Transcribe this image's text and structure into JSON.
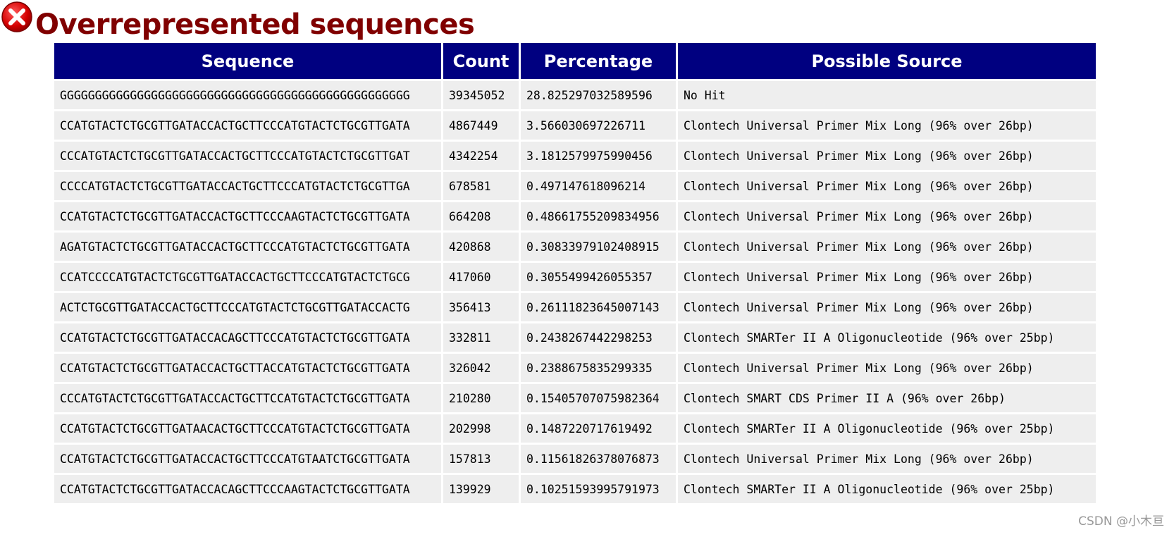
{
  "status": {
    "icon": "error-cross-icon",
    "color": "#cc0000"
  },
  "title": "Overrepresented sequences",
  "table": {
    "headers": {
      "sequence": "Sequence",
      "count": "Count",
      "percentage": "Percentage",
      "source": "Possible Source"
    },
    "rows": [
      {
        "sequence": "GGGGGGGGGGGGGGGGGGGGGGGGGGGGGGGGGGGGGGGGGGGGGGGGGG",
        "count": "39345052",
        "percentage": "28.825297032589596",
        "source": "No Hit"
      },
      {
        "sequence": "CCATGTACTCTGCGTTGATACCACTGCTTCCCATGTACTCTGCGTTGATA",
        "count": "4867449",
        "percentage": "3.566030697226711",
        "source": "Clontech Universal Primer Mix Long (96% over 26bp)"
      },
      {
        "sequence": "CCCATGTACTCTGCGTTGATACCACTGCTTCCCATGTACTCTGCGTTGAT",
        "count": "4342254",
        "percentage": "3.1812579975990456",
        "source": "Clontech Universal Primer Mix Long (96% over 26bp)"
      },
      {
        "sequence": "CCCCATGTACTCTGCGTTGATACCACTGCTTCCCATGTACTCTGCGTTGA",
        "count": "678581",
        "percentage": "0.497147618096214",
        "source": "Clontech Universal Primer Mix Long (96% over 26bp)"
      },
      {
        "sequence": "CCATGTACTCTGCGTTGATACCACTGCTTCCCAAGTACTCTGCGTTGATA",
        "count": "664208",
        "percentage": "0.48661755209834956",
        "source": "Clontech Universal Primer Mix Long (96% over 26bp)"
      },
      {
        "sequence": "AGATGTACTCTGCGTTGATACCACTGCTTCCCATGTACTCTGCGTTGATA",
        "count": "420868",
        "percentage": "0.30833979102408915",
        "source": "Clontech Universal Primer Mix Long (96% over 26bp)"
      },
      {
        "sequence": "CCATCCCCATGTACTCTGCGTTGATACCACTGCTTCCCATGTACTCTGCG",
        "count": "417060",
        "percentage": "0.3055499426055357",
        "source": "Clontech Universal Primer Mix Long (96% over 26bp)"
      },
      {
        "sequence": "ACTCTGCGTTGATACCACTGCTTCCCATGTACTCTGCGTTGATACCACTG",
        "count": "356413",
        "percentage": "0.26111823645007143",
        "source": "Clontech Universal Primer Mix Long (96% over 26bp)"
      },
      {
        "sequence": "CCATGTACTCTGCGTTGATACCACAGCTTCCCATGTACTCTGCGTTGATA",
        "count": "332811",
        "percentage": "0.2438267442298253",
        "source": "Clontech SMARTer II A Oligonucleotide (96% over 25bp)"
      },
      {
        "sequence": "CCATGTACTCTGCGTTGATACCACTGCTTACCATGTACTCTGCGTTGATA",
        "count": "326042",
        "percentage": "0.2388675835299335",
        "source": "Clontech Universal Primer Mix Long (96% over 26bp)"
      },
      {
        "sequence": "CCCATGTACTCTGCGTTGATACCACTGCTTCCATGTACTCTGCGTTGATA",
        "count": "210280",
        "percentage": "0.15405707075982364",
        "source": "Clontech SMART CDS Primer II A (96% over 26bp)"
      },
      {
        "sequence": "CCATGTACTCTGCGTTGATAACACTGCTTCCCATGTACTCTGCGTTGATA",
        "count": "202998",
        "percentage": "0.1487220717619492",
        "source": "Clontech SMARTer II A Oligonucleotide (96% over 25bp)"
      },
      {
        "sequence": "CCATGTACTCTGCGTTGATACCACTGCTTCCCATGTAATCTGCGTTGATA",
        "count": "157813",
        "percentage": "0.11561826378076873",
        "source": "Clontech Universal Primer Mix Long (96% over 26bp)"
      },
      {
        "sequence": "CCATGTACTCTGCGTTGATACCACAGCTTCCCAAGTACTCTGCGTTGATA",
        "count": "139929",
        "percentage": "0.10251593995791973",
        "source": "Clontech SMARTer II A Oligonucleotide (96% over 25bp)"
      }
    ]
  },
  "watermark": "CSDN @小木亘"
}
